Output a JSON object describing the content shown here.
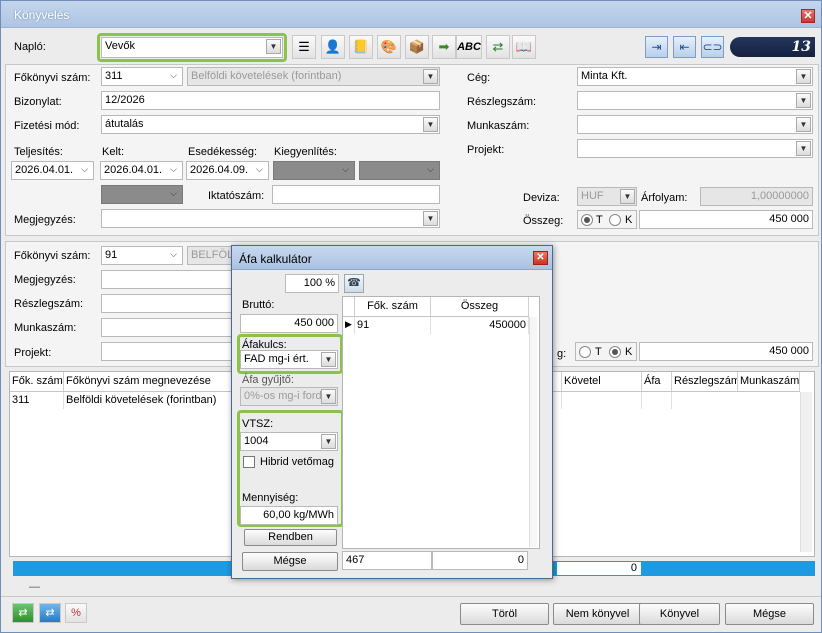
{
  "window": {
    "title": "Könyvelés"
  },
  "header": {
    "naplo_label": "Napló:",
    "naplo_value": "Vevők",
    "counter": "13",
    "toolbar_icons": [
      "document-list-icon",
      "person-icon",
      "book-user-icon",
      "palette-icon",
      "box-icon",
      "green-arrow-icon",
      "spellcheck-icon",
      "transfer-icon",
      "ledger-icon"
    ],
    "nav_icons": [
      "import-icon",
      "export-icon",
      "link-icon"
    ],
    "abc_label": "ABC"
  },
  "form": {
    "fokonyvi_label": "Főkönyvi szám:",
    "fokonyvi_value": "311",
    "fokonyvi_name": "Belföldi követelések (forintban)",
    "bizonylat_label": "Bizonylat:",
    "bizonylat_value": "12/2026",
    "fizetesi_label": "Fizetési mód:",
    "fizetesi_value": "átutalás",
    "teljesites_label": "Teljesítés:",
    "teljesites_value": "2026.04.01.",
    "kelt_label": "Kelt:",
    "kelt_value": "2026.04.01.",
    "esedekesseg_label": "Esedékesség:",
    "esedekesseg_value": "2026.04.09.",
    "kiegyenlites_label": "Kiegyenlítés:",
    "iktatoszam_label": "Iktatószám:",
    "megjegyzes_label": "Megjegyzés:",
    "ceg_label": "Cég:",
    "ceg_value": "Minta Kft.",
    "reszlegszam_label": "Részlegszám:",
    "munkaszam_label": "Munkaszám:",
    "projekt_label": "Projekt:",
    "deviza_label": "Deviza:",
    "deviza_value": "HUF",
    "arfolyam_label": "Árfolyam:",
    "arfolyam_value": "1,00000000",
    "osszeg_label": "Összeg:",
    "osszeg_value": "450 000",
    "radio_t": "T",
    "radio_k": "K"
  },
  "form2": {
    "fokonyvi_label": "Főkönyvi szám:",
    "fokonyvi_value": "91",
    "fokonyvi_name": "BELFÖLDI",
    "megjegyzes_label": "Megjegyzés:",
    "reszlegszam_label": "Részlegszám:",
    "munkaszam_label": "Munkaszám:",
    "projekt_label": "Projekt:",
    "osszeg_label_partial": "g:",
    "osszeg_value": "450 000",
    "radio_t": "T",
    "radio_k": "K"
  },
  "table": {
    "columns": [
      "Fők. szám",
      "Főkönyvi szám megnevezése",
      "Követel",
      "Áfa",
      "Részlegszám",
      "Munkaszám"
    ],
    "rows": [
      {
        "fok": "311",
        "name": "Belföldi követelések (forintban)"
      }
    ],
    "footer_value": "0",
    "footer_dash": "—"
  },
  "bottom": {
    "buttons": [
      "Töröl",
      "Nem könyvel",
      "Könyvel",
      "Mégse"
    ],
    "left_icons": [
      "swap-green-icon",
      "swap-blue-icon",
      "percent-edit-icon"
    ]
  },
  "dialog": {
    "title": "Áfa kalkulátor",
    "percent": "100 %",
    "brutto_label": "Bruttó:",
    "brutto_value": "450 000",
    "afakulcs_label": "Áfakulcs:",
    "afakulcs_value": "FAD mg-i ért.",
    "afagyujto_label": "Áfa gyűjtő:",
    "afagyujto_value": "0%-os mg-i ford",
    "vtsz_label": "VTSZ:",
    "vtsz_value": "1004",
    "hibrid_label": "Hibrid vetőmag",
    "mennyiseg_label": "Mennyiség:",
    "mennyiseg_value": "60,00 kg/MWh",
    "rendben": "Rendben",
    "megse": "Mégse",
    "grid_cols": [
      "Fők. szám",
      "Összeg"
    ],
    "grid_rows": [
      {
        "fok": "91",
        "osszeg": "450000"
      }
    ],
    "sum_left": "467",
    "sum_right": "0"
  },
  "colors": {
    "highlight": "#8bc34a",
    "footer_bar": "#1e9be0",
    "title": "#ffffff"
  }
}
